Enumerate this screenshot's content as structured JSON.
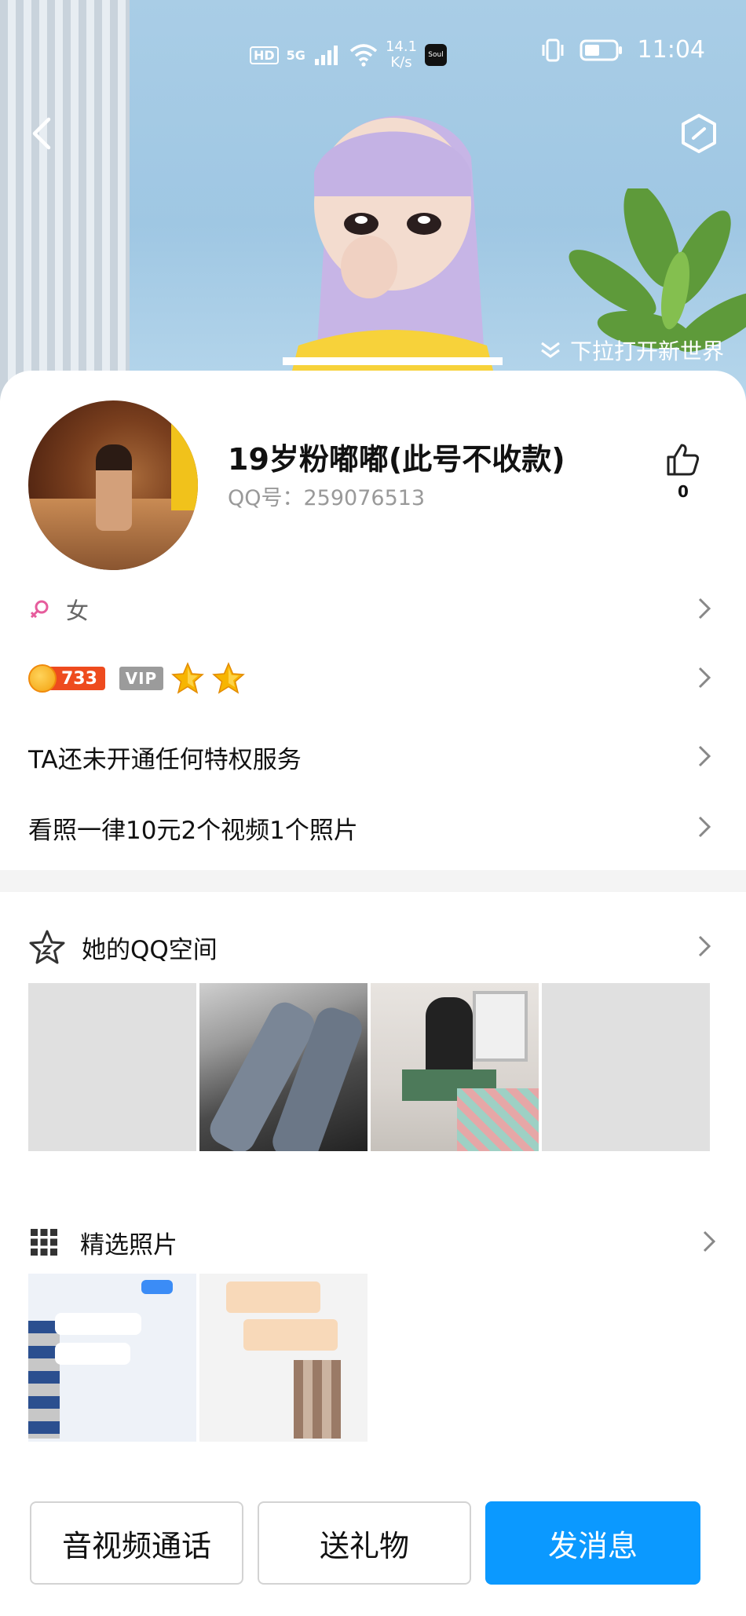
{
  "status_bar": {
    "hd": "HD",
    "signal": "5G",
    "net_speed_value": "14.1",
    "net_speed_unit": "K/s",
    "soul_label": "Soul",
    "time": "11:04"
  },
  "hero": {
    "pull_hint": "下拉打开新世界"
  },
  "profile": {
    "name": "19岁粉嘟嘟(此号不收款)",
    "qq_number": "QQ号：259076513",
    "like_count": "0",
    "gender": "女",
    "level_number": "733",
    "vip_label": "VIP",
    "privilege_text": "TA还未开通任何特权服务",
    "signature_text": "看照一律10元2个视频1个照片"
  },
  "sections": {
    "qzone_title": "她的QQ空间",
    "photos_title": "精选照片"
  },
  "actions": {
    "call": "音视频通话",
    "gift": "送礼物",
    "message": "发消息"
  },
  "colors": {
    "primary": "#0b99ff",
    "level_badge": "#ee4b1e",
    "star": "#f7b500"
  }
}
